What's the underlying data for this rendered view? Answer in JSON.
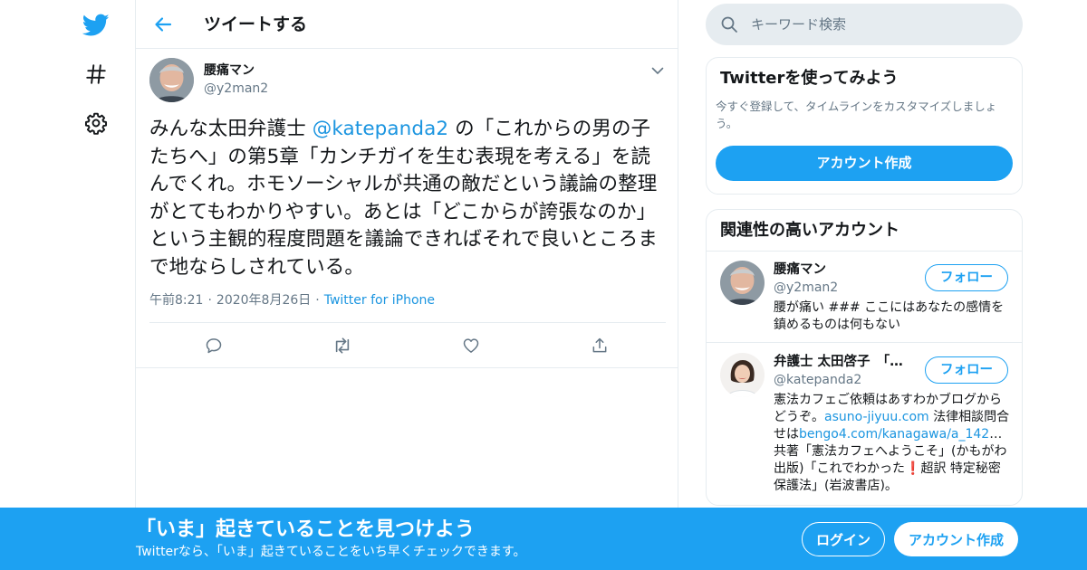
{
  "nav": {
    "icons": [
      "twitter-bird-icon",
      "hashtag-icon",
      "gear-icon"
    ]
  },
  "header": {
    "title": "ツイートする"
  },
  "tweet": {
    "author_name": "腰痛マン",
    "author_handle": "@y2man2",
    "text_part1": "みんな太田弁護士 ",
    "mention": "@katepanda2",
    "text_part2": " の「これからの男の子たちへ」の第5章「カンチガイを生む表現を考える」を読んでくれ。ホモソーシャルが共通の敵だという議論の整理がとてもわかりやすい。あとは「どこからが誇張なのか」という主観的程度問題を議論できればそれで良いところまで地ならしされている。",
    "time": "午前8:21",
    "date": "2020年8月26日",
    "separator": "·",
    "source": "Twitter for iPhone",
    "actions": [
      "reply-icon",
      "retweet-icon",
      "like-icon",
      "share-icon"
    ]
  },
  "search": {
    "placeholder": "キーワード検索"
  },
  "signup_card": {
    "title": "Twitterを使ってみよう",
    "description": "今すぐ登録して、タイムラインをカスタマイズしましょう。",
    "button": "アカウント作成"
  },
  "related": {
    "title": "関連性の高いアカウント",
    "accounts": [
      {
        "name": "腰痛マン",
        "handle": "@y2man2",
        "follow": "フォロー",
        "bio": "腰が痛い ### ここにはあなたの感情を鎮めるものは何もない"
      },
      {
        "name": "弁護士 太田啓子　「…",
        "handle": "@katepanda2",
        "follow": "フォロー",
        "bio_part1": "憲法カフェご依頼はあすわかブログからどうぞ。",
        "bio_link1": "asuno-jiyuu.com",
        "bio_part2": " 法律相談問合せは",
        "bio_link2": "bengo4.com/kanagawa/a_142",
        "bio_part3": "… 共著「憲法カフェへようこそ」(かもがわ出版)「これでわかった",
        "bio_emoji": "❗",
        "bio_part4": "超訳 特定秘密保護法」(岩波書店)。"
      }
    ]
  },
  "bottom_bar": {
    "title": "「いま」起きていることを見つけよう",
    "subtitle": "Twitterなら、「いま」起きていることをいち早くチェックできます。",
    "login": "ログイン",
    "signup": "アカウント作成"
  },
  "colors": {
    "brand": "#1da1f2",
    "link": "#1b95e0",
    "muted": "#657786",
    "border": "#e6ecf0"
  }
}
